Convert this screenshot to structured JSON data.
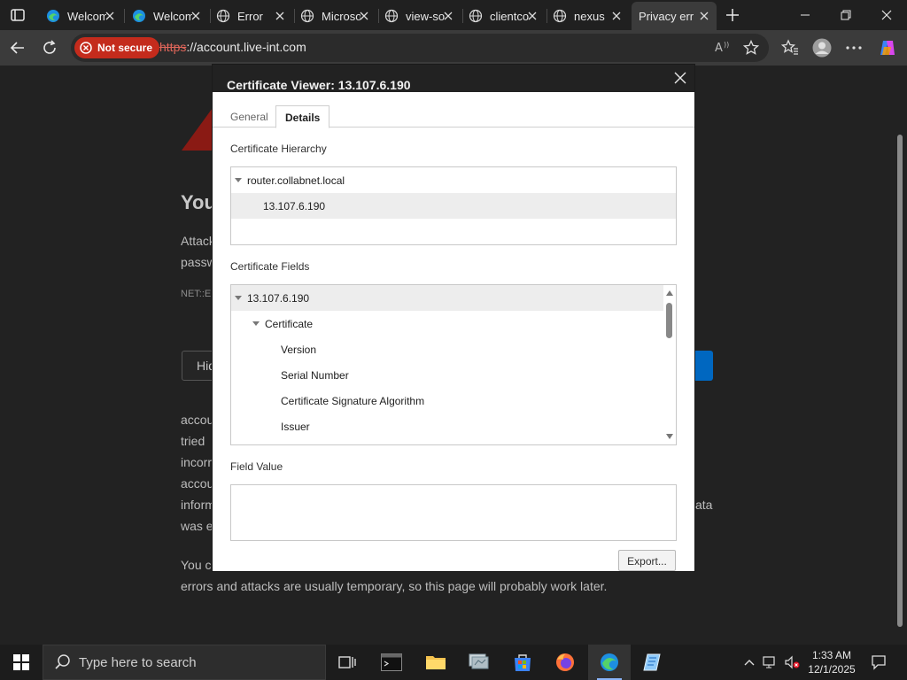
{
  "tabs": [
    {
      "title": "Welcome",
      "icon": "edge-icon"
    },
    {
      "title": "Welcome",
      "icon": "edge-icon"
    },
    {
      "title": "Error",
      "icon": "globe-icon"
    },
    {
      "title": "Microsoft",
      "icon": "globe-icon"
    },
    {
      "title": "view-source",
      "icon": "globe-icon"
    },
    {
      "title": "clientconfig",
      "icon": "globe-icon"
    },
    {
      "title": "nexus",
      "icon": "globe-icon"
    },
    {
      "title": "Privacy error",
      "icon": "none"
    }
  ],
  "address": {
    "security_label": "Not secure",
    "url_scheme": "https",
    "url_rest": "://account.live-int.com"
  },
  "page": {
    "heading": "You",
    "lines": [
      "Attack",
      "passw"
    ],
    "error_code": "NET::ER",
    "hide_button": "Hid",
    "para_lines": [
      "accou",
      "tried",
      "incorr",
      "accou",
      "inform",
      "was e"
    ],
    "para_right": "ata",
    "last_line_1": "You c",
    "last_line_2": "errors and attacks are usually temporary, so this page will probably work later."
  },
  "dialog": {
    "title": "Certificate Viewer: 13.107.6.190",
    "tabs": [
      "General",
      "Details"
    ],
    "active_tab": "Details",
    "hierarchy_label": "Certificate Hierarchy",
    "hierarchy": [
      "router.collabnet.local",
      "13.107.6.190"
    ],
    "fields_label": "Certificate Fields",
    "fields": [
      "13.107.6.190",
      "Certificate",
      "Version",
      "Serial Number",
      "Certificate Signature Algorithm",
      "Issuer"
    ],
    "value_label": "Field Value",
    "export_label": "Export..."
  },
  "taskbar": {
    "search_placeholder": "Type here to search",
    "time": "1:33 AM",
    "date": "12/1/2025"
  },
  "colors": {
    "not_secure": "#c42b1c",
    "accent": "#0067c0"
  }
}
